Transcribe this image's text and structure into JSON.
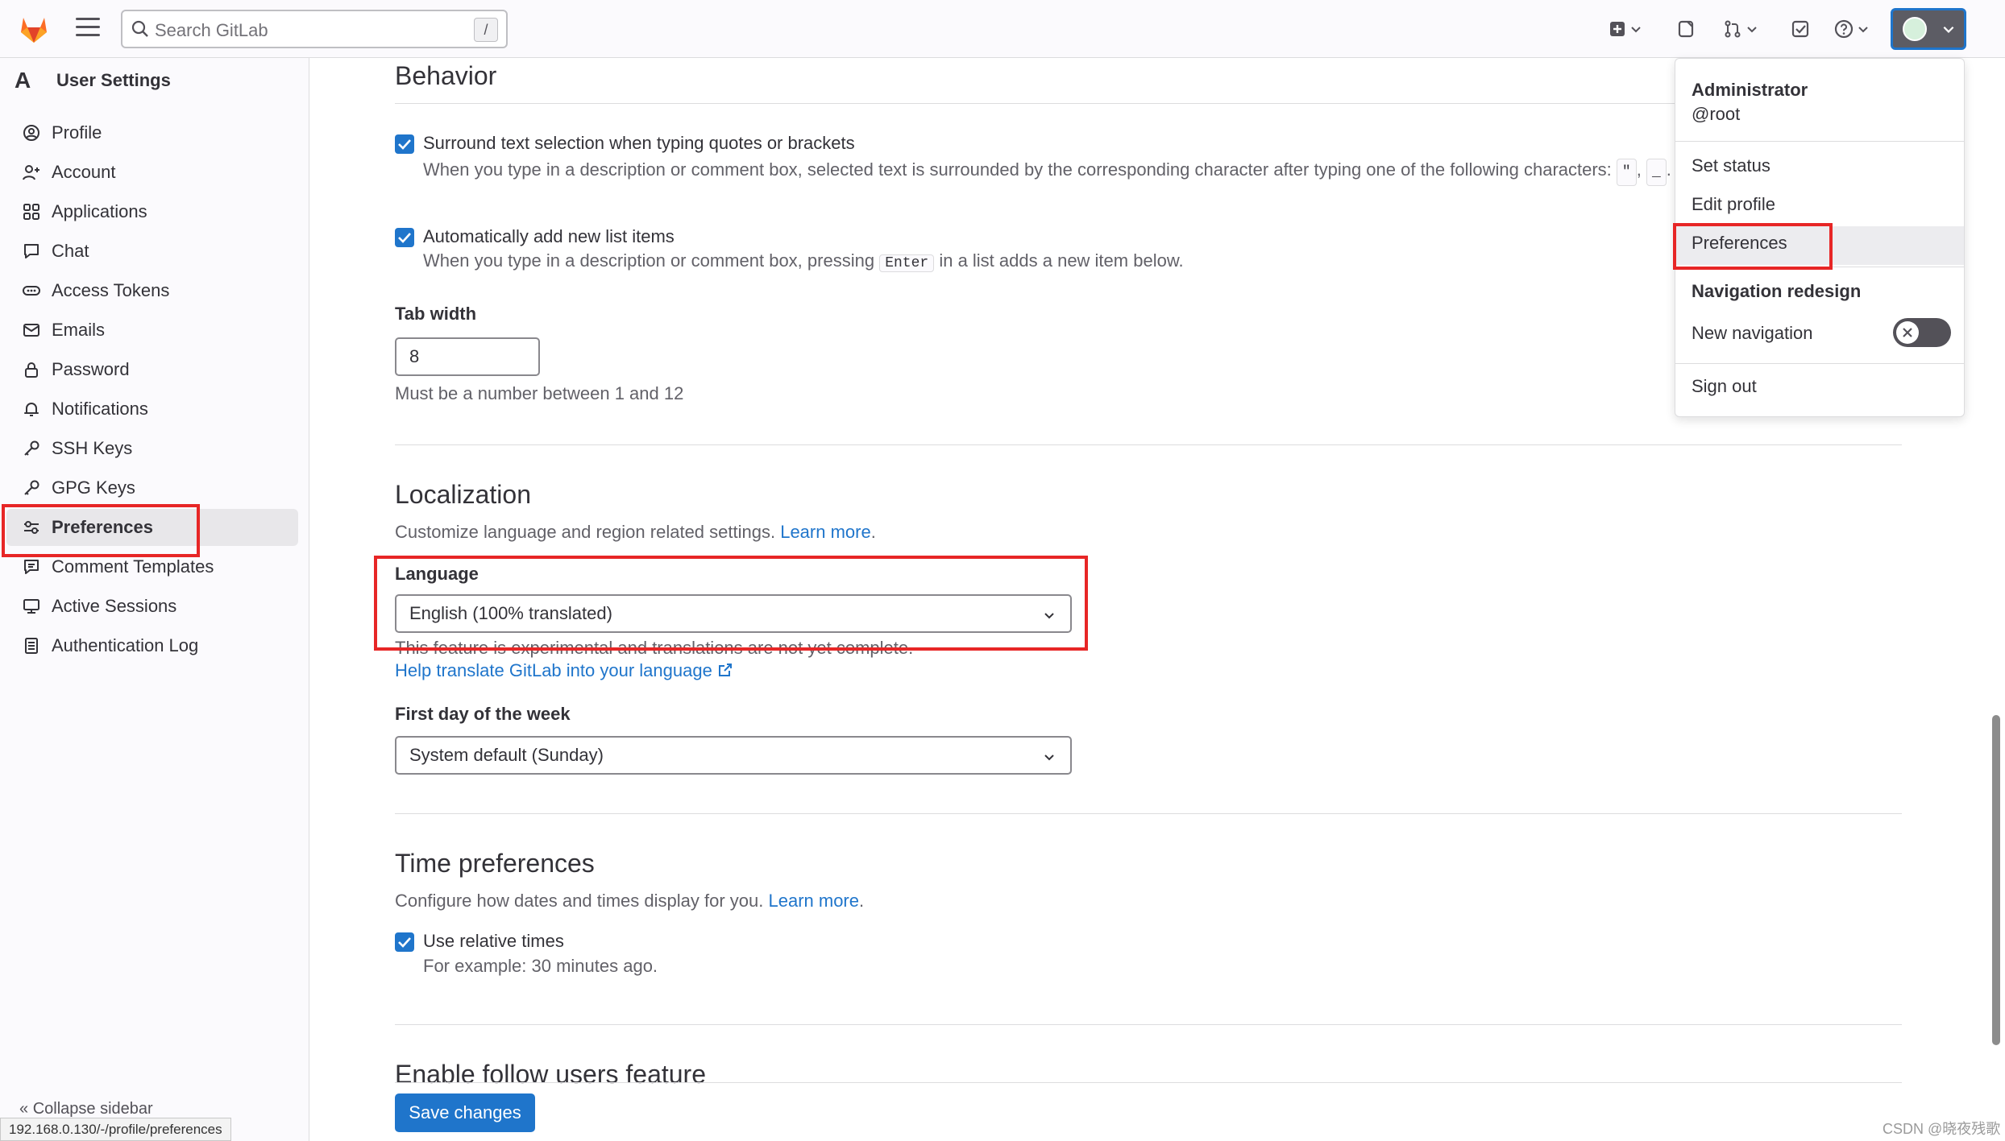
{
  "topbar": {
    "search_placeholder": "Search GitLab",
    "search_shortcut": "/",
    "icons": [
      "gitlab-logo",
      "menu-icon",
      "plus-square-icon",
      "issues-icon",
      "merge-request-icon",
      "todo-icon",
      "help-icon",
      "user-avatar"
    ]
  },
  "sidebar": {
    "title": "User Settings",
    "broken_avatar_alt": "A",
    "items": [
      {
        "label": "Profile",
        "icon": "profile-icon"
      },
      {
        "label": "Account",
        "icon": "account-icon"
      },
      {
        "label": "Applications",
        "icon": "applications-icon"
      },
      {
        "label": "Chat",
        "icon": "chat-icon"
      },
      {
        "label": "Access Tokens",
        "icon": "token-icon"
      },
      {
        "label": "Emails",
        "icon": "mail-icon"
      },
      {
        "label": "Password",
        "icon": "lock-icon"
      },
      {
        "label": "Notifications",
        "icon": "bell-icon"
      },
      {
        "label": "SSH Keys",
        "icon": "key-icon"
      },
      {
        "label": "GPG Keys",
        "icon": "key-icon"
      },
      {
        "label": "Preferences",
        "icon": "preferences-icon",
        "active": true
      },
      {
        "label": "Comment Templates",
        "icon": "comment-icon"
      },
      {
        "label": "Active Sessions",
        "icon": "monitor-icon"
      },
      {
        "label": "Authentication Log",
        "icon": "log-icon"
      }
    ],
    "collapse_label": "Collapse sidebar",
    "status_url": "192.168.0.130/-/profile/preferences"
  },
  "behavior": {
    "heading": "Behavior",
    "surround_label": "Surround text selection when typing quotes or brackets",
    "surround_help": "When you type in a description or comment box, selected text is surrounded by the corresponding character after typing one of the following characters:",
    "surround_code1": "\"",
    "surround_code2": "_",
    "surround_end": ".",
    "auto_list_label": "Automatically add new list items",
    "auto_list_help_a": "When you type in a description or comment box, pressing",
    "auto_list_code": "Enter",
    "auto_list_help_b": "in a list adds a new item below.",
    "tab_width_label": "Tab width",
    "tab_width_value": "8",
    "tab_width_help": "Must be a number between 1 and 12"
  },
  "localization": {
    "heading": "Localization",
    "desc": "Customize language and region related settings.",
    "learn_more": "Learn more",
    "period": ".",
    "language_label": "Language",
    "language_value": "English (100% translated)",
    "language_help": "This feature is experimental and translations are not yet complete.",
    "translate_link": "Help translate GitLab into your language",
    "first_day_label": "First day of the week",
    "first_day_value": "System default (Sunday)"
  },
  "time_prefs": {
    "heading": "Time preferences",
    "desc": "Configure how dates and times display for you.",
    "learn_more": "Learn more",
    "period": ".",
    "relative_label": "Use relative times",
    "relative_help": "For example: 30 minutes ago."
  },
  "follow": {
    "heading": "Enable follow users feature"
  },
  "save_button": "Save changes",
  "user_menu": {
    "name": "Administrator",
    "username": "@root",
    "set_status": "Set status",
    "edit_profile": "Edit profile",
    "preferences": "Preferences",
    "nav_redesign": "Navigation redesign",
    "new_navigation": "New navigation",
    "new_navigation_on": false,
    "sign_out": "Sign out"
  },
  "watermark": "CSDN @晓夜残歌",
  "colors": {
    "accent": "#1f75cb",
    "highlight": "#e72626",
    "gitlab_orange": "#fc6d26"
  }
}
